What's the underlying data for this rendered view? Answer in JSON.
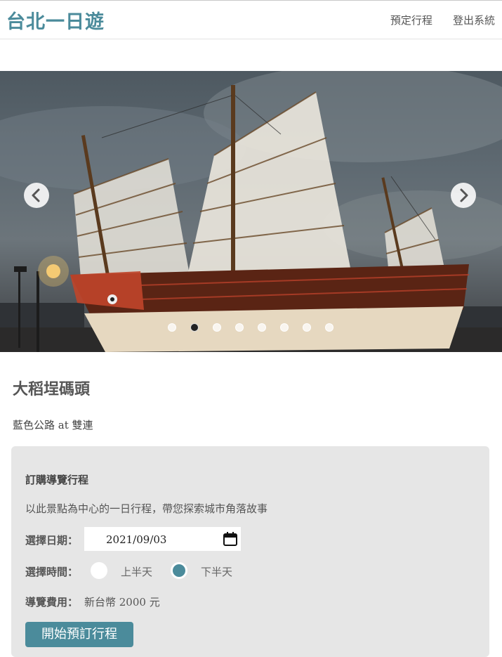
{
  "navbar": {
    "brand": "台北一日遊",
    "links": [
      "預定行程",
      "登出系統"
    ]
  },
  "carousel": {
    "slide_count": 8,
    "active_index": 1,
    "prev_icon": "chevron-left-icon",
    "next_icon": "chevron-right-icon"
  },
  "attraction": {
    "name": "大稻埕碼頭",
    "category_and_mrt": "藍色公路 at 雙連"
  },
  "booking": {
    "title": "訂購導覽行程",
    "description": "以此景點為中心的一日行程，帶您探索城市角落故事",
    "date_label": "選擇日期：",
    "date_value": "2021/09/03",
    "time_label": "選擇時間：",
    "time_options": [
      {
        "label": "上半天",
        "checked": false
      },
      {
        "label": "下半天",
        "checked": true
      }
    ],
    "fee_label": "導覽費用：",
    "fee_value": "新台幣 2000 元",
    "submit_label": "開始預訂行程"
  },
  "colors": {
    "accent": "#4b8b9b",
    "panel_background": "#e6e6e6"
  }
}
